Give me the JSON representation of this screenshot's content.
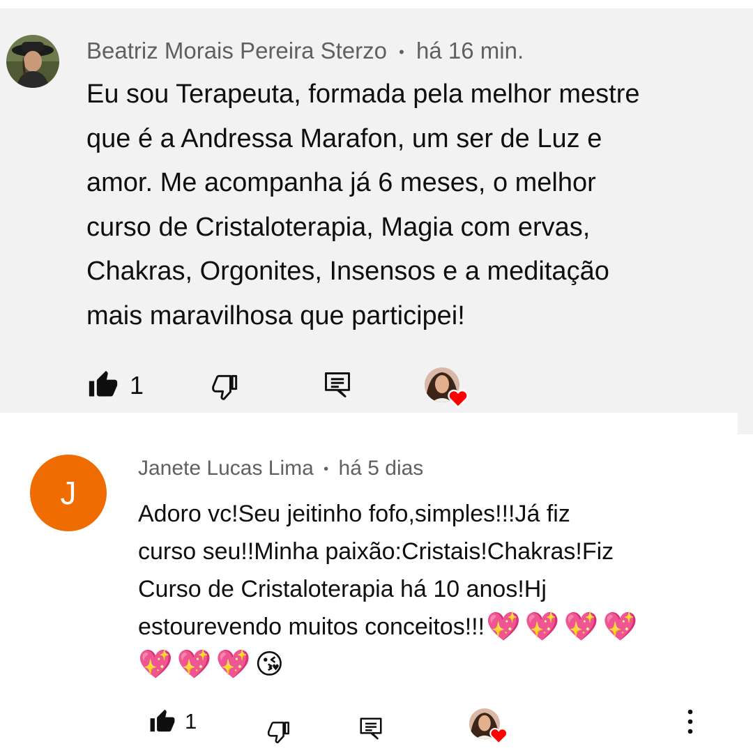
{
  "comments": [
    {
      "author": "Beatriz Morais Pereira Sterzo",
      "separator": "•",
      "time": "há 16 min.",
      "lines": [
        "Eu sou Terapeuta, formada pela melhor mestre",
        "que é a Andressa Marafon, um ser de Luz e",
        "amor. Me acompanha já 6 meses, o melhor",
        "curso de Cristaloterapia, Magia com ervas,",
        "Chakras, Orgonites, Insensos e a meditação",
        "mais maravilhosa que participei!"
      ],
      "likes": "1",
      "avatar_icon": "user-photo-avatar",
      "creator_heart_icon": "creator-heart-avatar"
    },
    {
      "author": "Janete Lucas Lima",
      "separator": "•",
      "time": "há 5 dias",
      "avatar_letter": "J",
      "avatar_color": "#ef6c00",
      "lines": [
        "Adoro vc!Seu jeitinho fofo,simples!!!Já fiz",
        "curso seu!!Minha paixão:Cristais!Chakras!Fiz",
        "Curso de Cristaloterapia há 10 anos!Hj",
        "estourevendo muitos conceitos!!!"
      ],
      "emoji_line1": [
        "💖",
        "💖",
        "💖",
        "💖"
      ],
      "emoji_line2": [
        "💖",
        "💖",
        "💖",
        "😘"
      ],
      "likes": "1",
      "creator_heart_icon": "creator-heart-avatar",
      "menu_icon": "more-vertical-icon"
    }
  ],
  "colors": {
    "background": "#ffffff",
    "highlight": "#f2f2f2",
    "meta": "#606060",
    "text": "#0f0f0f",
    "heart": "#ff0000"
  }
}
